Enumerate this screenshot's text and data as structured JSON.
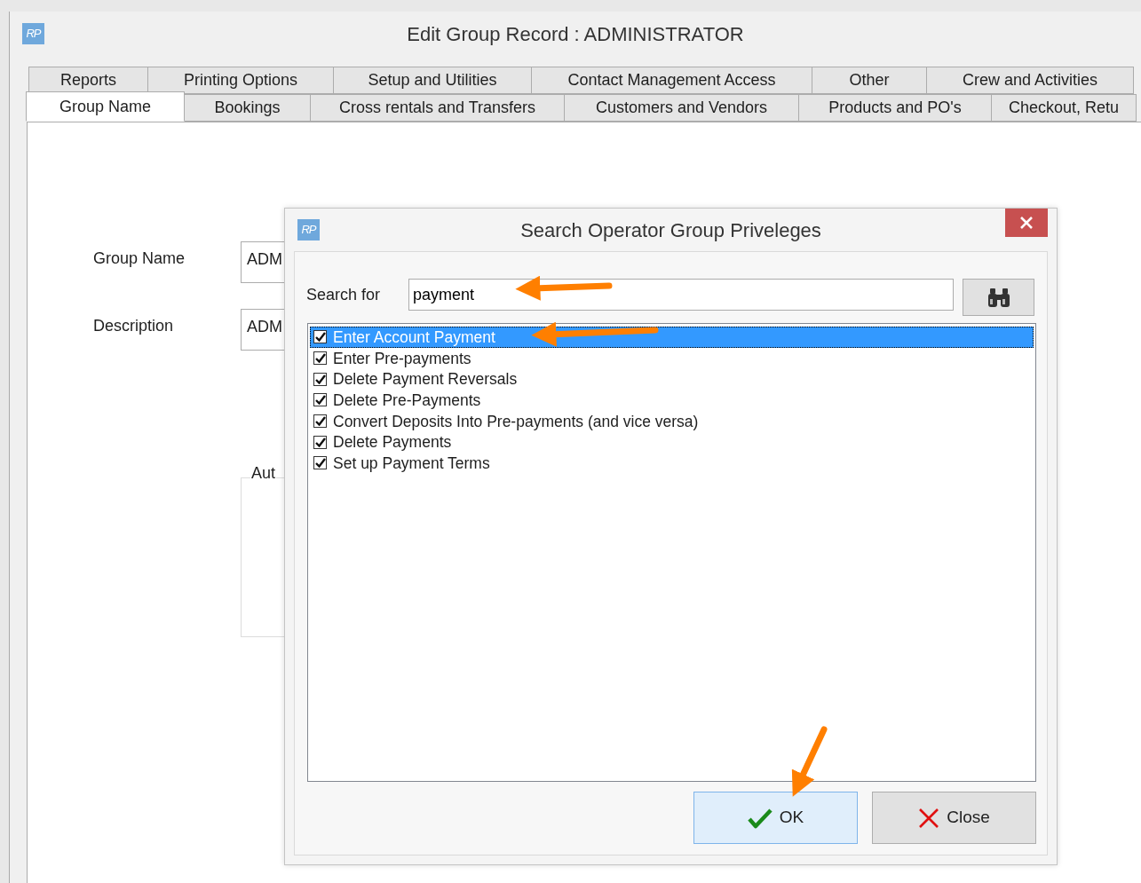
{
  "window": {
    "logo": "RP",
    "title": "Edit Group Record : ADMINISTRATOR"
  },
  "tabs": {
    "rows": [
      [
        {
          "label": "Reports",
          "selected": false
        },
        {
          "label": "Printing Options",
          "selected": false
        },
        {
          "label": "Setup and Utilities",
          "selected": false
        },
        {
          "label": "Contact Management Access",
          "selected": false
        },
        {
          "label": "Other",
          "selected": false
        },
        {
          "label": "Crew and Activities",
          "selected": false
        }
      ],
      [
        {
          "label": "Group Name",
          "selected": true
        },
        {
          "label": "Bookings",
          "selected": false
        },
        {
          "label": "Cross rentals and Transfers",
          "selected": false
        },
        {
          "label": "Customers and Vendors",
          "selected": false
        },
        {
          "label": "Products and PO's",
          "selected": false
        },
        {
          "label": "Checkout, Retu",
          "selected": false
        }
      ]
    ]
  },
  "form": {
    "fields": [
      {
        "label": "Group Name",
        "value": "ADM"
      },
      {
        "label": "Description",
        "value": "ADM"
      }
    ],
    "group_box": {
      "title": "Aut"
    }
  },
  "dialog": {
    "logo": "RP",
    "title": "Search Operator Group Priveleges",
    "search": {
      "label": "Search for",
      "value": "payment"
    },
    "items": [
      {
        "label": "Enter Account Payment",
        "checked": true,
        "selected": true
      },
      {
        "label": "Enter Pre-payments",
        "checked": true,
        "selected": false
      },
      {
        "label": "Delete Payment Reversals",
        "checked": true,
        "selected": false
      },
      {
        "label": "Delete Pre-Payments",
        "checked": true,
        "selected": false
      },
      {
        "label": "Convert Deposits Into Pre-payments (and vice versa)",
        "checked": true,
        "selected": false
      },
      {
        "label": "Delete Payments",
        "checked": true,
        "selected": false
      },
      {
        "label": "Set up Payment Terms",
        "checked": true,
        "selected": false
      }
    ],
    "buttons": [
      {
        "kind": "ok",
        "label": "OK",
        "default": true
      },
      {
        "kind": "close",
        "label": "Close",
        "default": false
      }
    ]
  }
}
